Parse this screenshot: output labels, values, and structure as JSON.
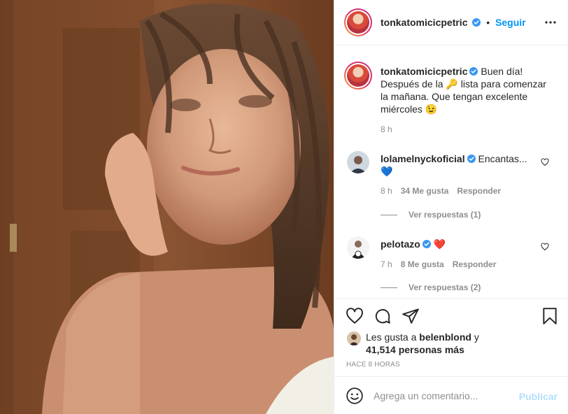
{
  "post": {
    "author": "tonkatomicicpetric",
    "follow_label": "Seguir",
    "dot": "•",
    "caption_pre": "Buen día! Después de la ",
    "caption_emoji": "🔑",
    "caption_post": " lista para comenzar la mañana. Que tengan excelente miércoles ",
    "caption_smiley": "😉",
    "caption_time": "8 h"
  },
  "comments": [
    {
      "user": "lolamelnyckoficial",
      "text": "Encantas...",
      "emoji": "💙",
      "time": "8 h",
      "likes": "34 Me gusta",
      "reply_label": "Responder",
      "view_replies": "Ver respuestas (1)"
    },
    {
      "user": "pelotazo",
      "emoji": "❤️",
      "time": "7 h",
      "likes": "8 Me gusta",
      "reply_label": "Responder",
      "view_replies": "Ver respuestas (2)"
    }
  ],
  "likes": {
    "prefix": "Les gusta a ",
    "user": "belenblond",
    "joiner": " y",
    "count": "41,514 personas más"
  },
  "timestamp": "HACE 8 HORAS",
  "composer": {
    "placeholder": "Agrega un comentario...",
    "publish": "Publicar"
  },
  "icons": {
    "verified": "verified-badge-icon",
    "more": "more-options-icon",
    "like": "heart-outline-icon",
    "comment": "comment-bubble-icon",
    "share": "paper-plane-icon",
    "save": "bookmark-icon",
    "emoji": "emoji-smile-icon"
  },
  "colors": {
    "accent": "#0095f6",
    "verified": "#3897f0",
    "muted": "#8e8e8e",
    "publish_disabled": "#b2dffc",
    "heart_red": "#ed4956"
  }
}
